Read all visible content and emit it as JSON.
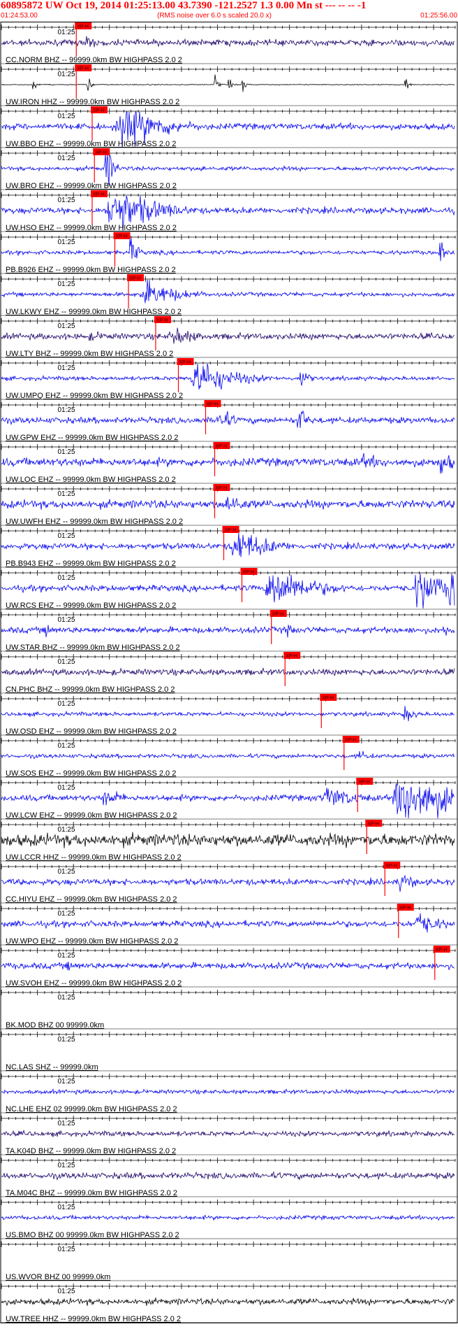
{
  "header": {
    "title": "60895872 UW Oct 19, 2014 01:25:13.00   43.7390 -121.2527  1.3 0.00 Mn st --- -- --  -1",
    "start_time": "01:24:53.00",
    "rms_note": "(RMS noise over 6.0 s scaled 20.0 x)",
    "end_time": "01:25:56.00"
  },
  "tick_label": "01:25",
  "pick_label": "XP-H",
  "colors": {
    "header": "#ff0000",
    "trace_blue": "#0000ee",
    "trace_navy": "#1a0066",
    "trace_black": "#000000",
    "pick": "#ff0000",
    "axis": "#000000"
  },
  "traces": [
    {
      "label": "CC.NORM BHZ -- 99999.0km BW  HIGHPASS  2.0  2",
      "color": "navy",
      "amp": 3,
      "pick": 0.165,
      "events": [
        [
          0.19,
          8,
          0.02
        ]
      ]
    },
    {
      "label": "UW.IRON HHZ -- 99999.0km BW  HIGHPASS  2.0  2",
      "color": "black",
      "amp": 0.5,
      "pick": 0.165,
      "events": [
        [
          0.07,
          10,
          0.004
        ],
        [
          0.19,
          10,
          0.004
        ],
        [
          0.47,
          12,
          0.004
        ],
        [
          0.5,
          9,
          0.004
        ],
        [
          0.53,
          11,
          0.004
        ],
        [
          0.89,
          10,
          0.004
        ]
      ]
    },
    {
      "label": "UW.BBO EHZ -- 99999.0km BW  HIGHPASS  2.0  2",
      "color": "blue",
      "amp": 3,
      "pick": 0.2,
      "events": [
        [
          0.27,
          24,
          0.06
        ]
      ]
    },
    {
      "label": "UW.BRO EHZ -- 99999.0km BW  HIGHPASS  2.0  2",
      "color": "blue",
      "amp": 2,
      "pick": 0.205,
      "events": [
        [
          0.23,
          28,
          0.01
        ],
        [
          0.44,
          8,
          0.005
        ]
      ]
    },
    {
      "label": "UW.HSO EHZ -- 99999.0km BW  HIGHPASS  2.0  2",
      "color": "blue",
      "amp": 3,
      "pick": 0.2,
      "events": [
        [
          0.25,
          26,
          0.06
        ]
      ]
    },
    {
      "label": "PB.B926 EHZ -- 99999.0km BW  HIGHPASS  2.0  2",
      "color": "blue",
      "amp": 2,
      "pick": 0.25,
      "events": [
        [
          0.285,
          18,
          0.01
        ],
        [
          0.965,
          22,
          0.005
        ]
      ]
    },
    {
      "label": "UW.LKWY EHZ -- 99999.0km BW  HIGHPASS  2.0  2",
      "color": "blue",
      "amp": 2,
      "pick": 0.28,
      "events": [
        [
          0.32,
          14,
          0.05
        ]
      ]
    },
    {
      "label": "UW.LTY BHZ -- 99999.0km BW  HIGHPASS  2.0  2",
      "color": "navy",
      "amp": 3,
      "pick": 0.34,
      "events": [
        [
          0.38,
          10,
          0.04
        ],
        [
          0.2,
          5,
          0.05
        ]
      ]
    },
    {
      "label": "UW.UMPQ EHZ -- 99999.0km BW  HIGHPASS  2.0  2",
      "color": "blue",
      "amp": 2,
      "pick": 0.39,
      "events": [
        [
          0.43,
          22,
          0.05
        ],
        [
          0.66,
          16,
          0.01
        ]
      ]
    },
    {
      "label": "UW.GPW EHZ -- 99999.0km BW  HIGHPASS  2.0  2",
      "color": "blue",
      "amp": 3,
      "pick": 0.45,
      "events": [
        [
          0.48,
          14,
          0.02
        ],
        [
          0.655,
          22,
          0.01
        ]
      ]
    },
    {
      "label": "UW.LOC EHZ -- 99999.0km BW  HIGHPASS  2.0  2",
      "color": "blue",
      "amp": 4,
      "pick": 0.47,
      "events": [
        [
          0.8,
          8,
          0.05
        ],
        [
          0.97,
          14,
          0.02
        ]
      ]
    },
    {
      "label": "UW.UWFH EHZ -- 99999.0km BW  HIGHPASS  2.0  2",
      "color": "blue",
      "amp": 4,
      "pick": 0.47,
      "events": [
        [
          0.5,
          12,
          0.03
        ]
      ]
    },
    {
      "label": "PB.B943 EHZ -- 99999.0km BW  HIGHPASS  2.0  2",
      "color": "blue",
      "amp": 3,
      "pick": 0.49,
      "events": [
        [
          0.52,
          18,
          0.05
        ]
      ]
    },
    {
      "label": "UW.RCS EHZ -- 99999.0km BW  HIGHPASS  2.0  2",
      "color": "blue",
      "amp": 3,
      "pick": 0.53,
      "events": [
        [
          0.6,
          22,
          0.06
        ],
        [
          0.92,
          28,
          0.03
        ],
        [
          0.99,
          26,
          0.02
        ]
      ]
    },
    {
      "label": "UW.STAR BHZ -- 99999.0km BW  HIGHPASS  2.0  2",
      "color": "blue",
      "amp": 3,
      "pick": 0.595,
      "events": [
        [
          0.1,
          10,
          0.01
        ],
        [
          0.63,
          10,
          0.01
        ],
        [
          0.975,
          14,
          0.005
        ]
      ]
    },
    {
      "label": "CN.PHC BHZ -- 99999.0km BW  HIGHPASS  2.0  2",
      "color": "navy",
      "amp": 3,
      "pick": 0.625,
      "events": []
    },
    {
      "label": "UW.OSD EHZ -- 99999.0km BW  HIGHPASS  2.0  2",
      "color": "blue",
      "amp": 2,
      "pick": 0.705,
      "events": [
        [
          0.89,
          8,
          0.02
        ]
      ]
    },
    {
      "label": "UW.SOS EHZ -- 99999.0km BW  HIGHPASS  2.0  2",
      "color": "blue",
      "amp": 2,
      "pick": 0.755,
      "events": [
        [
          0.79,
          6,
          0.02
        ]
      ]
    },
    {
      "label": "UW.LCW EHZ -- 99999.0km BW  HIGHPASS  2.0  2",
      "color": "blue",
      "amp": 3,
      "pick": 0.785,
      "events": [
        [
          0.23,
          10,
          0.03
        ],
        [
          0.72,
          12,
          0.05
        ],
        [
          0.89,
          30,
          0.09
        ]
      ]
    },
    {
      "label": "UW.LCCR HHZ -- 99999.0km BW  HIGHPASS  2.0  2",
      "color": "black",
      "amp": 6,
      "pick": 0.805,
      "events": []
    },
    {
      "label": "CC.HIYU EHZ -- 99999.0km BW  HIGHPASS  2.0  2",
      "color": "blue",
      "amp": 3,
      "pick": 0.845,
      "events": [
        [
          0.88,
          12,
          0.02
        ]
      ]
    },
    {
      "label": "UW.WPO EHZ -- 99999.0km BW  HIGHPASS  2.0  2",
      "color": "blue",
      "amp": 3,
      "pick": 0.875,
      "events": [
        [
          0.92,
          14,
          0.03
        ]
      ]
    },
    {
      "label": "UW.SVOH EHZ -- 99999.0km BW  HIGHPASS  2.0  2",
      "color": "blue",
      "amp": 3,
      "pick": 0.955,
      "events": [
        [
          0.15,
          5,
          0.04
        ]
      ]
    },
    {
      "label": "BK.MOD BHZ 00 99999.0km",
      "color": "none",
      "amp": 0,
      "pick": null,
      "events": []
    },
    {
      "label": "NC.LAS SHZ -- 99999.0km",
      "color": "none",
      "amp": 0,
      "pick": null,
      "events": []
    },
    {
      "label": "NC.LHE EHZ 02 99999.0km BW  HIGHPASS  2.0  2",
      "color": "blue",
      "amp": 2,
      "pick": null,
      "events": []
    },
    {
      "label": "TA.K04D BHZ -- 99999.0km BW  HIGHPASS  2.0  2",
      "color": "navy",
      "amp": 2.5,
      "pick": null,
      "events": []
    },
    {
      "label": "TA.M04C BHZ -- 99999.0km BW  HIGHPASS  2.0  2",
      "color": "navy",
      "amp": 3,
      "pick": null,
      "events": []
    },
    {
      "label": "US.BMO BHZ 00 99999.0km BW  HIGHPASS  2.0  2",
      "color": "blue",
      "amp": 2,
      "pick": null,
      "events": [
        [
          0.96,
          6,
          0.01
        ]
      ]
    },
    {
      "label": "US.WVOR BHZ 00 99999.0km",
      "color": "none",
      "amp": 0,
      "pick": null,
      "events": []
    },
    {
      "label": "UW.TREE HHZ -- 99999.0km BW  HIGHPASS  2.0  2",
      "color": "black",
      "amp": 3,
      "pick": null,
      "events": []
    }
  ]
}
